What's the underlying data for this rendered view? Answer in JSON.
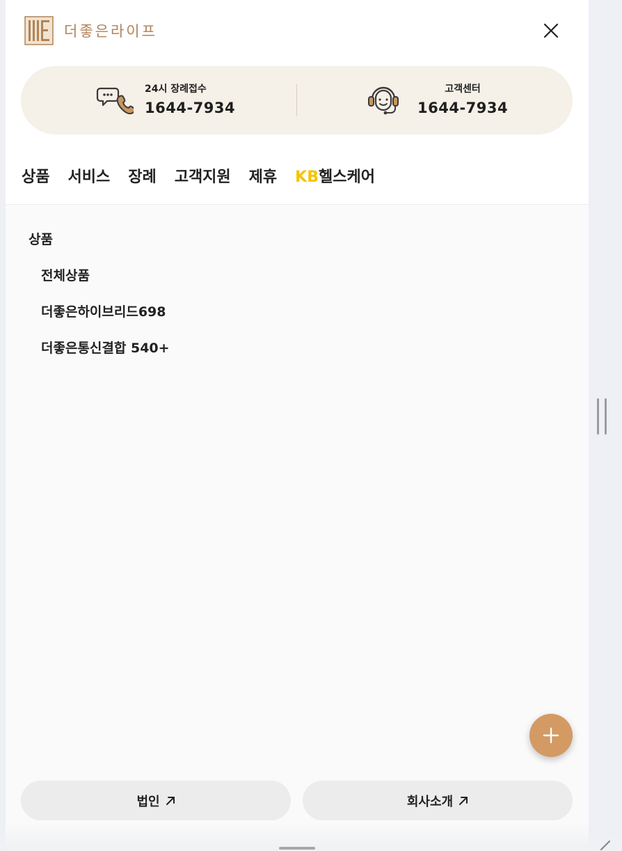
{
  "brand": {
    "name": "더좋은라이프"
  },
  "contacts": [
    {
      "label": "24시 장례접수",
      "phone": "1644-7934",
      "icon": "chat-phone-icon"
    },
    {
      "label": "고객센터",
      "phone": "1644-7934",
      "icon": "headset-icon"
    }
  ],
  "nav": {
    "items": [
      "상품",
      "서비스",
      "장례",
      "고객지원",
      "제휴"
    ],
    "kb_prefix": "KB",
    "kb_rest": "헬스케어"
  },
  "submenu": {
    "title": "상품",
    "items": [
      "전체상품",
      "더좋은하이브리드698",
      "더좋은통신결합 540+"
    ]
  },
  "bottom_buttons": [
    {
      "label": "법인",
      "icon": "external-arrow-icon"
    },
    {
      "label": "회사소개",
      "icon": "external-arrow-icon"
    }
  ],
  "colors": {
    "brand": "#b08458",
    "contact_bg": "#f5f0e8",
    "kb_yellow": "#f5c400",
    "fab": "#d39a64"
  }
}
